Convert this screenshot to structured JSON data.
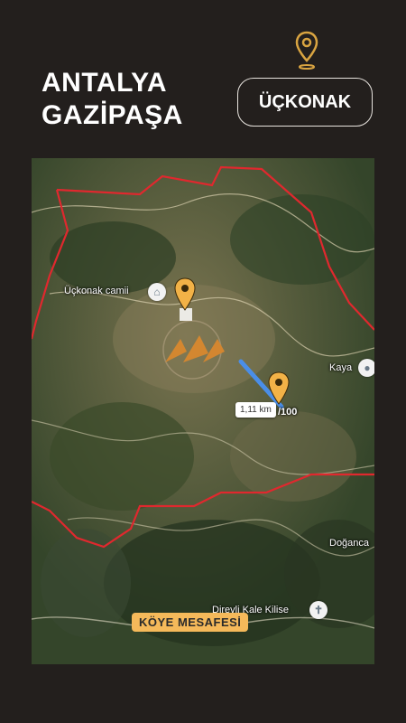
{
  "header": {
    "title_line1": "ANTALYA",
    "title_line2": "GAZİPAŞA",
    "village": "ÜÇKONAK"
  },
  "map": {
    "labels": {
      "mosque": "Üçkonak camii",
      "kaya": "Kaya",
      "doganca": "Doğanca",
      "church": "Direvli Kale Kilise"
    },
    "distance": "1,11 km",
    "road_number": "/100",
    "caption": "KÖYE MESAFESİ"
  },
  "colors": {
    "background": "#231f1d",
    "boundary": "#e0282e",
    "route": "#4a8ee8",
    "marker": "#f2b247",
    "caption_bg": "#f5b95a"
  },
  "icons": [
    "location-pin-icon",
    "mosque-icon",
    "church-icon",
    "map-marker-icon"
  ]
}
